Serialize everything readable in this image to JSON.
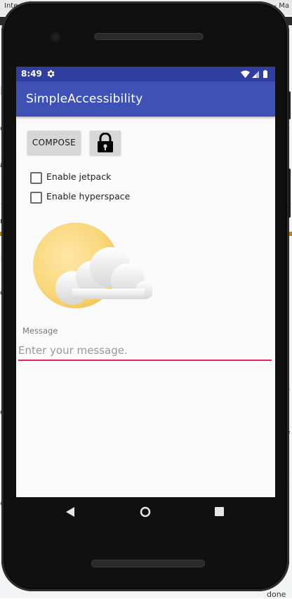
{
  "status_bar": {
    "time": "8:49",
    "background_color": "#303f9f",
    "icons": [
      "gear-icon",
      "wifi-icon",
      "signal-icon",
      "battery-icon"
    ]
  },
  "app_bar": {
    "title": "SimpleAccessibility",
    "background_color": "#3f51b5"
  },
  "toolbar": {
    "compose_label": "COMPOSE",
    "lock_icon": "lock-icon"
  },
  "checkboxes": [
    {
      "label": "Enable jetpack",
      "checked": false
    },
    {
      "label": "Enable hyperspace",
      "checked": false
    }
  ],
  "image": {
    "icon": "partly-cloudy-icon"
  },
  "message": {
    "label": "Message",
    "placeholder": "Enter your message.",
    "value": "",
    "accent_color": "#e91e63"
  },
  "nav_bar": {
    "icons": [
      "back-icon",
      "home-icon",
      "recents-icon"
    ]
  },
  "background_window": {
    "title_left": "Inte",
    "title_right": "- - Ma",
    "side_text_left": [
      "e",
      "M",
      "b",
      "n",
      "N",
      "o",
      "o",
      "e"
    ],
    "side_text_right": [
      "e",
      "e",
      "e",
      "p",
      "fi",
      "e",
      "e",
      "done"
    ]
  }
}
